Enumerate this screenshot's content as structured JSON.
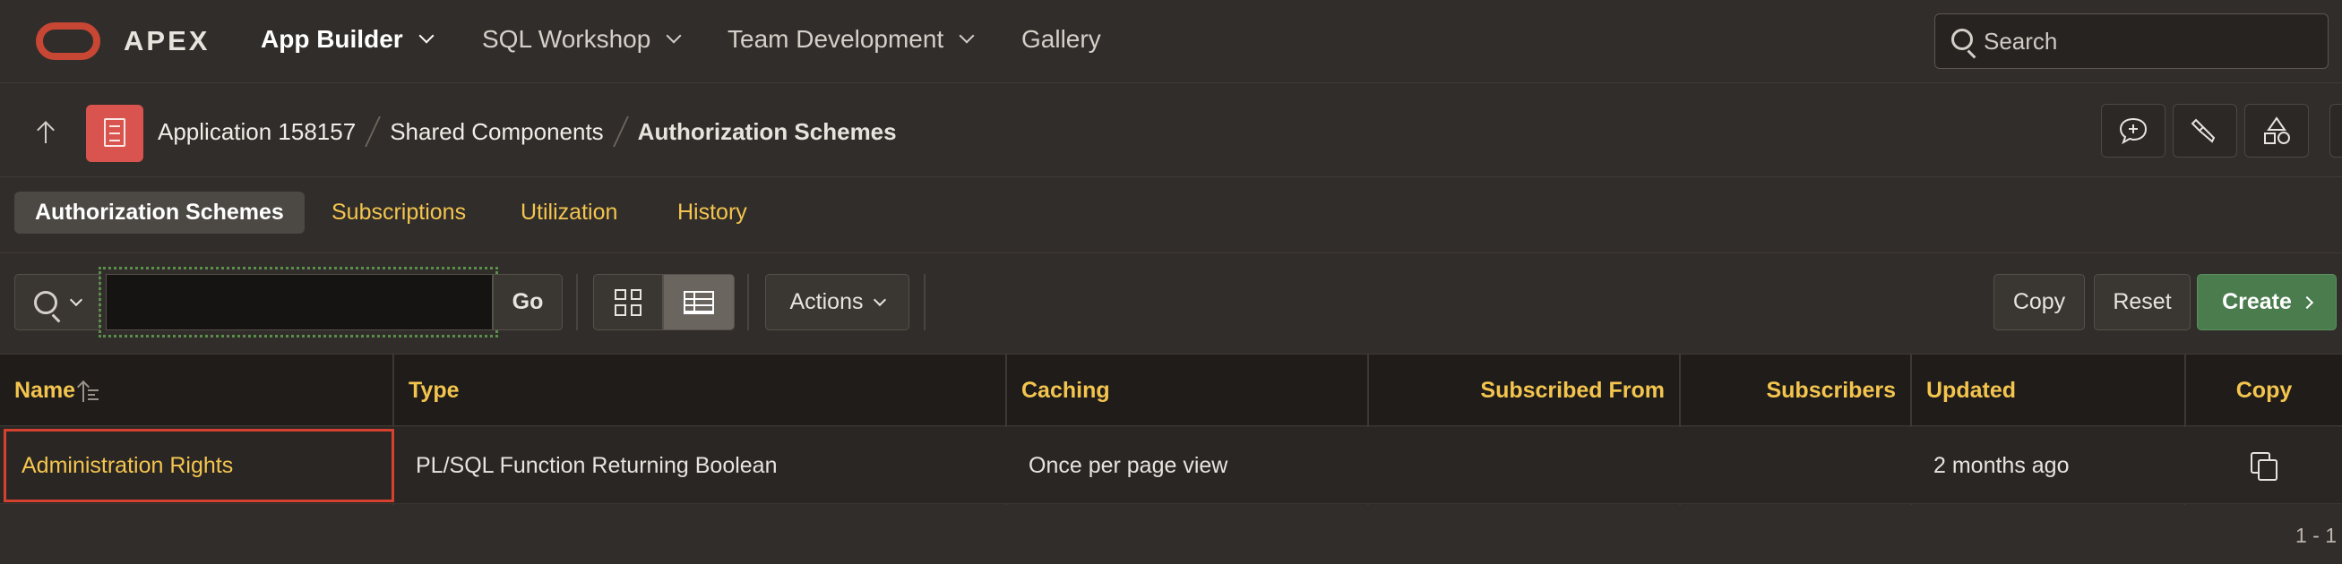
{
  "header": {
    "brand": "APEX",
    "nav": [
      {
        "label": "App Builder",
        "active": true,
        "has_menu": true
      },
      {
        "label": "SQL Workshop",
        "active": false,
        "has_menu": true
      },
      {
        "label": "Team Development",
        "active": false,
        "has_menu": true
      },
      {
        "label": "Gallery",
        "active": false,
        "has_menu": false
      }
    ],
    "search_placeholder": "Search"
  },
  "breadcrumb": {
    "items": [
      "Application 158157",
      "Shared Components",
      "Authorization Schemes"
    ],
    "tools": [
      "feedback-icon",
      "developer-tools-icon",
      "shapes-icon"
    ]
  },
  "tabs": [
    {
      "label": "Authorization Schemes",
      "active": true
    },
    {
      "label": "Subscriptions",
      "active": false
    },
    {
      "label": "Utilization",
      "active": false
    },
    {
      "label": "History",
      "active": false
    }
  ],
  "toolbar": {
    "search_value": "",
    "go_label": "Go",
    "view_mode": "report",
    "actions_label": "Actions",
    "copy_label": "Copy",
    "reset_label": "Reset",
    "create_label": "Create"
  },
  "table": {
    "columns": [
      "Name",
      "Type",
      "Caching",
      "Subscribed From",
      "Subscribers",
      "Updated",
      "Copy"
    ],
    "rows": [
      {
        "name": "Administration Rights",
        "type": "PL/SQL Function Returning Boolean",
        "caching": "Once per page view",
        "subscribed_from": "",
        "subscribers": "",
        "updated": "2 months ago",
        "copy_icon": "copy-icon"
      }
    ],
    "pagination": "1 - 1"
  },
  "colors": {
    "background": "#312d2a",
    "link": "#f4c54e",
    "oracle_red": "#c74634",
    "create_green": "#4a7c4e",
    "highlight_outline": "#d4412f"
  }
}
